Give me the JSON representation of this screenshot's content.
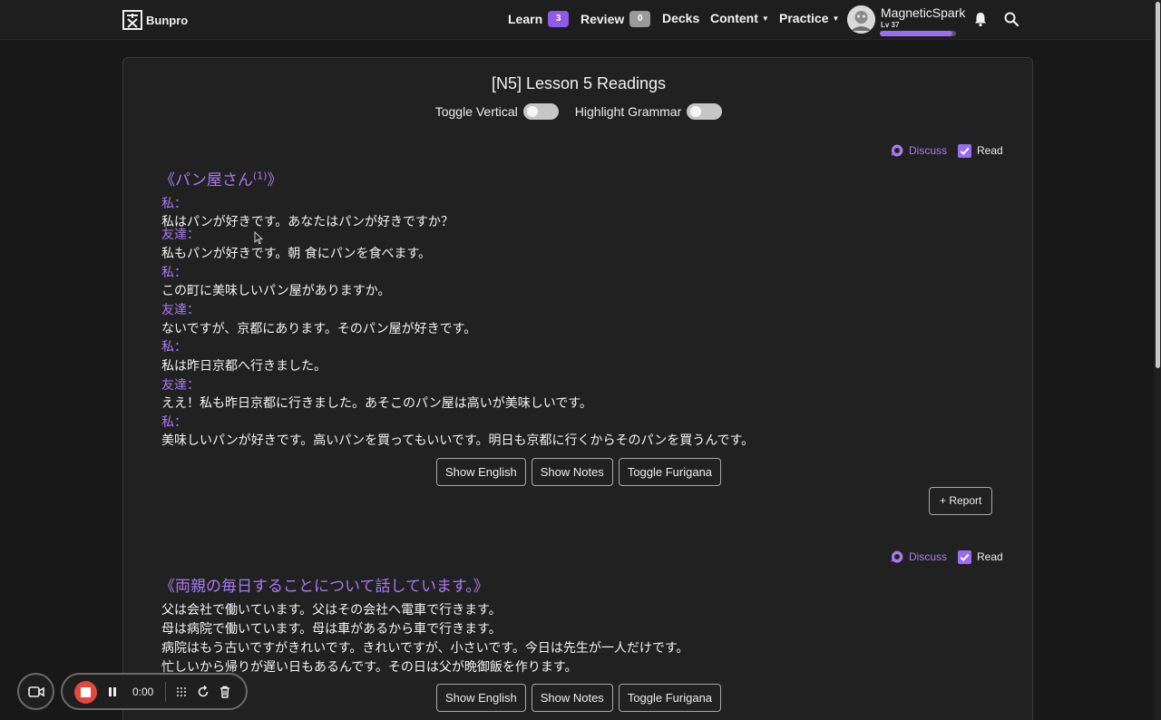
{
  "nav": {
    "brand": "Bunpro",
    "learn_label": "Learn",
    "learn_count": "3",
    "review_label": "Review",
    "review_count": "0",
    "decks_label": "Decks",
    "content_label": "Content",
    "practice_label": "Practice",
    "username": "MagneticSpark",
    "level": "Lv 37",
    "level_progress": 0.95
  },
  "page": {
    "title": "[N5] Lesson 5 Readings",
    "toggle_vertical": "Toggle Vertical",
    "highlight_grammar": "Highlight Grammar"
  },
  "reading1": {
    "discuss": "Discuss",
    "read": "Read",
    "title": "《パン屋さん",
    "title_sup": "(1)",
    "title_end": "》",
    "speakers": [
      "私：",
      "友達：",
      "私：",
      "友達：",
      "私：",
      "友達：",
      "私："
    ],
    "lines": [
      "私はパンが好きです。あなたはパンが好きですか？",
      "私もパンが好きです。朝 食にパンを食べます。",
      "この町に美味しいパン屋がありますか。",
      "ないですが、京都にあります。そのパン屋が好きです。",
      "私は昨日京都へ行きました。",
      "ええ！私も昨日京都に行きました。あそこのパン屋は高いが美味しいです。",
      "美味しいパンが好きです。高いパンを買ってもいいです。明日も京都に行くからそのパンを買うんです。"
    ],
    "show_english": "Show English",
    "show_notes": "Show Notes",
    "toggle_furigana": "Toggle Furigana",
    "report": "+ Report"
  },
  "reading2": {
    "discuss": "Discuss",
    "read": "Read",
    "title": "《両親の毎日することについて話しています。》",
    "lines": [
      "父は会社で働いています。父はその会社へ電車で行きます。",
      "母は病院で働いています。母は車があるから車で行きます。",
      "病院はもう古いですがきれいです。きれいですが、小さいです。今日は先生が一人だけです。",
      "忙しいから帰りが遅い日もあるんです。その日は父が晩御飯を作ります。"
    ],
    "show_english": "Show English",
    "show_notes": "Show Notes",
    "toggle_furigana": "Toggle Furigana"
  },
  "recorder": {
    "time": "0:00"
  },
  "colors": {
    "accent": "#9a6cf0",
    "speaker": "#a87af5",
    "background": "#181818",
    "card": "#212121",
    "record": "#e2483b"
  }
}
